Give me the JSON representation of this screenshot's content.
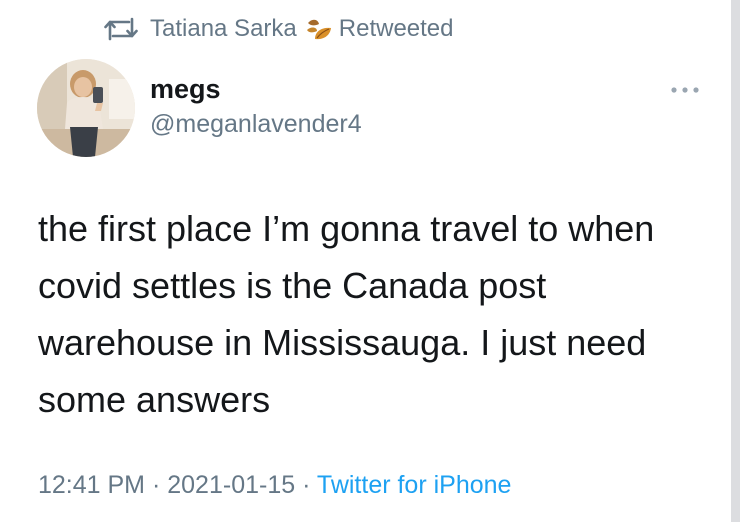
{
  "retweet": {
    "name": "Tatiana Sarka",
    "label": "Retweeted",
    "icon": "retweet-icon",
    "emoji": "leaf-emoji"
  },
  "author": {
    "display_name": "megs",
    "handle": "@meganlavender4"
  },
  "menu": {
    "icon": "more-horizontal-icon"
  },
  "tweet": {
    "lines": [
      "the first place I’m gonna travel to when",
      "covid settles is the Canada post",
      "warehouse in Mississauga. I just need",
      "some answers"
    ]
  },
  "meta": {
    "time": "12:41 PM",
    "separator": "·",
    "date": "2021-01-15",
    "source": "Twitter for iPhone"
  },
  "colors": {
    "text": "#14171a",
    "secondary": "#657786",
    "link": "#1da1f2"
  }
}
